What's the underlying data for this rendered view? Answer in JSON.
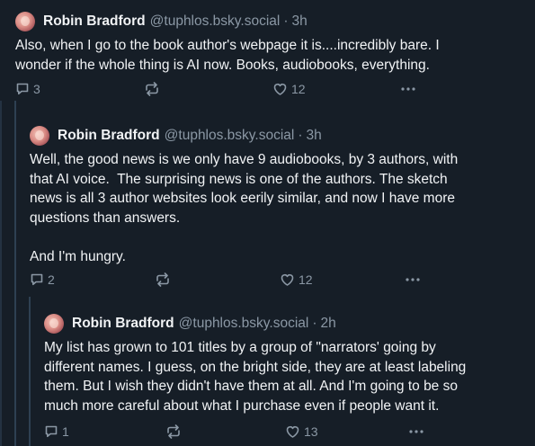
{
  "colors": {
    "background": "#161e27",
    "text": "#f1f3f5",
    "muted": "#8b98a5",
    "thread_line": "#2e4052"
  },
  "posts": [
    {
      "author": "Robin Bradford",
      "handle": "@tuphlos.bsky.social",
      "separator": "·",
      "time": "3h",
      "text": "Also, when I go to the book author's webpage it is....incredibly bare. I\nwonder if the whole thing is AI now. Books, audiobooks, everything.",
      "replies": "3",
      "reposts": "",
      "likes": "12",
      "icons": [
        "reply-icon",
        "repost-icon",
        "like-icon",
        "more-icon"
      ]
    },
    {
      "author": "Robin Bradford",
      "handle": "@tuphlos.bsky.social",
      "separator": "·",
      "time": "3h",
      "text": "Well, the good news is we only have 9 audiobooks, by 3 authors, with\nthat AI voice.  The surprising news is one of the authors. The sketch\nnews is all 3 author websites look eerily similar, and now I have more\nquestions than answers.\n\nAnd I'm hungry.",
      "replies": "2",
      "reposts": "",
      "likes": "12",
      "icons": [
        "reply-icon",
        "repost-icon",
        "like-icon",
        "more-icon"
      ]
    },
    {
      "author": "Robin Bradford",
      "handle": "@tuphlos.bsky.social",
      "separator": "·",
      "time": "2h",
      "text": "My list has grown to 101 titles by a group of \"narrators' going by\ndifferent names. I guess, on the bright side, they are at least labeling\nthem. But I wish they didn't have them at all. And I'm going to be so\nmuch more careful about what I purchase even if people want it.",
      "replies": "1",
      "reposts": "",
      "likes": "13",
      "icons": [
        "reply-icon",
        "repost-icon",
        "like-icon",
        "more-icon"
      ]
    }
  ]
}
